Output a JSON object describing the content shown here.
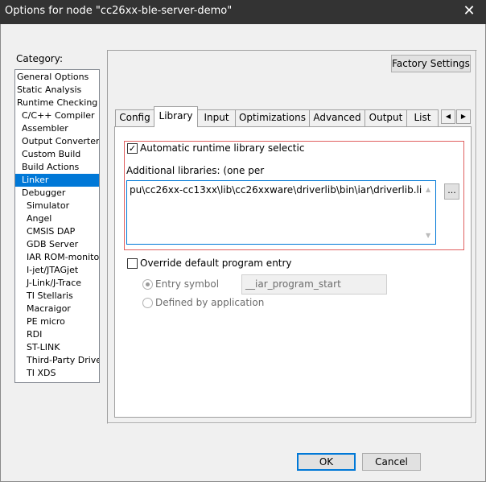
{
  "window": {
    "title": "Options for node \"cc26xx-ble-server-demo\"",
    "close_glyph": "✕"
  },
  "category": {
    "label": "Category:",
    "selected": "Linker",
    "items": [
      "General Options",
      "Static Analysis",
      "Runtime Checking",
      "C/C++ Compiler",
      "Assembler",
      "Output Converter",
      "Custom Build",
      "Build Actions",
      "Linker",
      "Debugger",
      "Simulator",
      "Angel",
      "CMSIS DAP",
      "GDB Server",
      "IAR ROM-monitor",
      "I-jet/JTAGjet",
      "J-Link/J-Trace",
      "TI Stellaris",
      "Macraigor",
      "PE micro",
      "RDI",
      "ST-LINK",
      "Third-Party Driver",
      "TI XDS"
    ]
  },
  "factory_settings_label": "Factory Settings",
  "tabs": {
    "active": "Library",
    "items": [
      "Config",
      "Library",
      "Input",
      "Optimizations",
      "Advanced",
      "Output",
      "List"
    ],
    "scroll_left_icon": "◀",
    "scroll_right_icon": "▶"
  },
  "library": {
    "auto_runtime_label": "Automatic runtime library selectic",
    "auto_runtime_checked": true,
    "checkmark_glyph": "✓",
    "additional_label": "Additional libraries: (one per",
    "additional_value": "pu\\cc26xx-cc13xx\\lib\\cc26xxware\\driverlib\\bin\\iar\\driverlib.lib",
    "browse_label": "...",
    "override_label": "Override default program entry",
    "override_checked": false,
    "entry_symbol_label": "Entry symbol",
    "entry_symbol_value": "__iar_program_start",
    "defined_by_app_label": "Defined by application",
    "scroll_up_glyph": "▲",
    "scroll_down_glyph": "▼"
  },
  "buttons": {
    "ok": "OK",
    "cancel": "Cancel"
  }
}
